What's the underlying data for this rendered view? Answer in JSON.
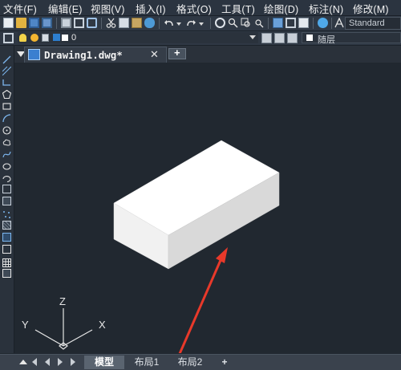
{
  "menubar": {
    "items": [
      "文件(F)",
      "编辑(E)",
      "视图(V)",
      "插入(I)",
      "格式(O)",
      "工具(T)",
      "绘图(D)",
      "标注(N)",
      "修改(M)"
    ]
  },
  "toolbar": {
    "text_style": "Standard"
  },
  "layer_bar": {
    "current_layer": "0",
    "color_value": "随层"
  },
  "document": {
    "tab_title": "Drawing1.dwg*",
    "close_symbol": "✕",
    "new_tab_symbol": "+"
  },
  "ucs": {
    "z_label": "Z",
    "y_label": "Y",
    "x_label": "X"
  },
  "layout_tabs": {
    "model": "模型",
    "layout1": "布局1",
    "layout2": "布局2",
    "add": "+"
  },
  "colors": {
    "background": "#212830",
    "box_top": "#ffffff",
    "box_front": "#f0f0f0",
    "box_side": "#d6d6d6",
    "annotation_arrow": "#e8392a"
  }
}
